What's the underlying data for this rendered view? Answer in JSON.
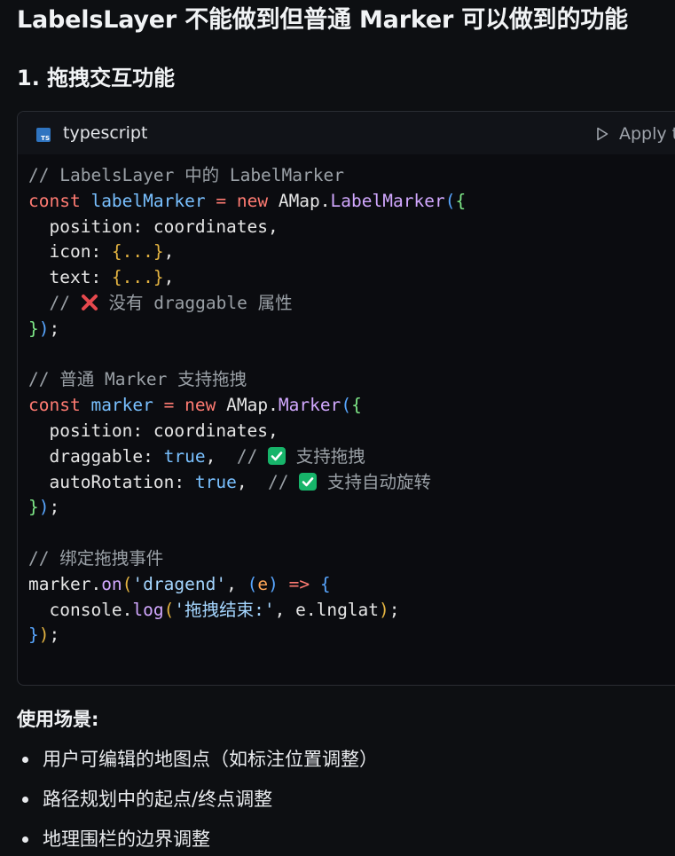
{
  "heading": "LabelsLayer 不能做到但普通 Marker 可以做到的功能",
  "section": "1. 拖拽交互功能",
  "code_block": {
    "language_badge": "TS",
    "language": "typescript",
    "apply_label": "Apply to",
    "lines": {
      "l1": "// LabelsLayer 中的 LabelMarker",
      "l5_comment_pre": "// ",
      "l5_comment_post": " 没有 draggable 属性",
      "l8": "// 普通 Marker 支持拖拽",
      "l11_comment_post": " 支持拖拽",
      "l12_comment_post": " 支持自动旋转",
      "l15": "// 绑定拖拽事件",
      "l17_str": "'拖拽结束:'"
    }
  },
  "scenarios": {
    "title": "使用场景:",
    "items": [
      "用户可编辑的地图点（如标注位置调整）",
      "路径规划中的起点/终点调整",
      "地理围栏的边界调整"
    ]
  },
  "colors": {
    "background": "#0d0f12",
    "code_background": "#0b0c10",
    "keyword": "#ff7b72",
    "identifier": "#79c0ff",
    "function": "#d2a8ff",
    "comment": "#9aa0a6",
    "check_green": "#17b46a",
    "cross_red": "#e5484d"
  }
}
